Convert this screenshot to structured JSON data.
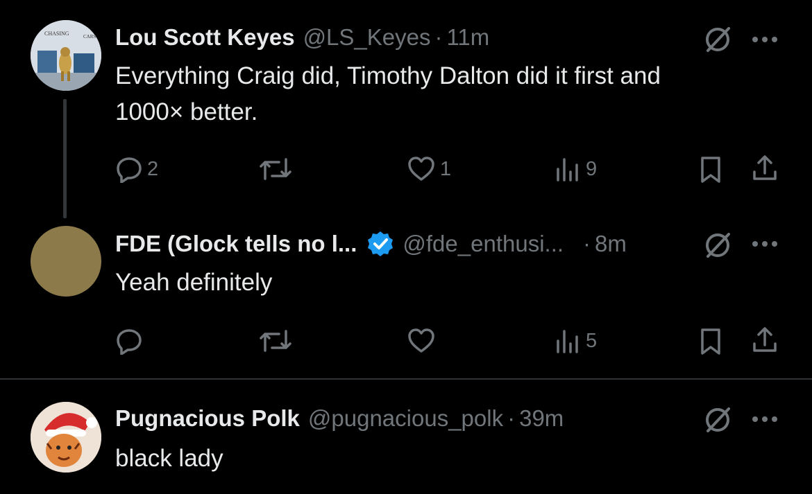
{
  "tweets": [
    {
      "name": "Lou Scott Keyes",
      "handle": "@LS_Keyes",
      "time": "11m",
      "text_line1": "Everything Craig did, Timothy Dalton did it first and",
      "text_line2": "1000× better.",
      "replies": "2",
      "likes": "1",
      "views": "9",
      "avatar_text_top": "CHASING",
      "avatar_text_right": "CARS"
    },
    {
      "name": "FDE (Glock tells no l...",
      "handle": "@fde_enthusi...",
      "time": "8m",
      "text": "Yeah definitely",
      "views": "5",
      "verified": true,
      "avatar_color": "#8c7a4b",
      "verified_color": "#1d9bf0"
    },
    {
      "name": "Pugnacious Polk",
      "handle": "@pugnacious_polk",
      "time": "39m",
      "text": "black lady"
    }
  ],
  "separator": "·",
  "icons": {
    "reply": "reply-icon",
    "retweet": "retweet-icon",
    "like": "like-icon",
    "views": "views-icon",
    "bookmark": "bookmark-icon",
    "share": "share-icon",
    "grok": "grok-icon",
    "more": "more-icon"
  },
  "colors": {
    "background": "#000000",
    "text": "#e7e9ea",
    "muted": "#71767b",
    "divider": "#2f3336"
  }
}
